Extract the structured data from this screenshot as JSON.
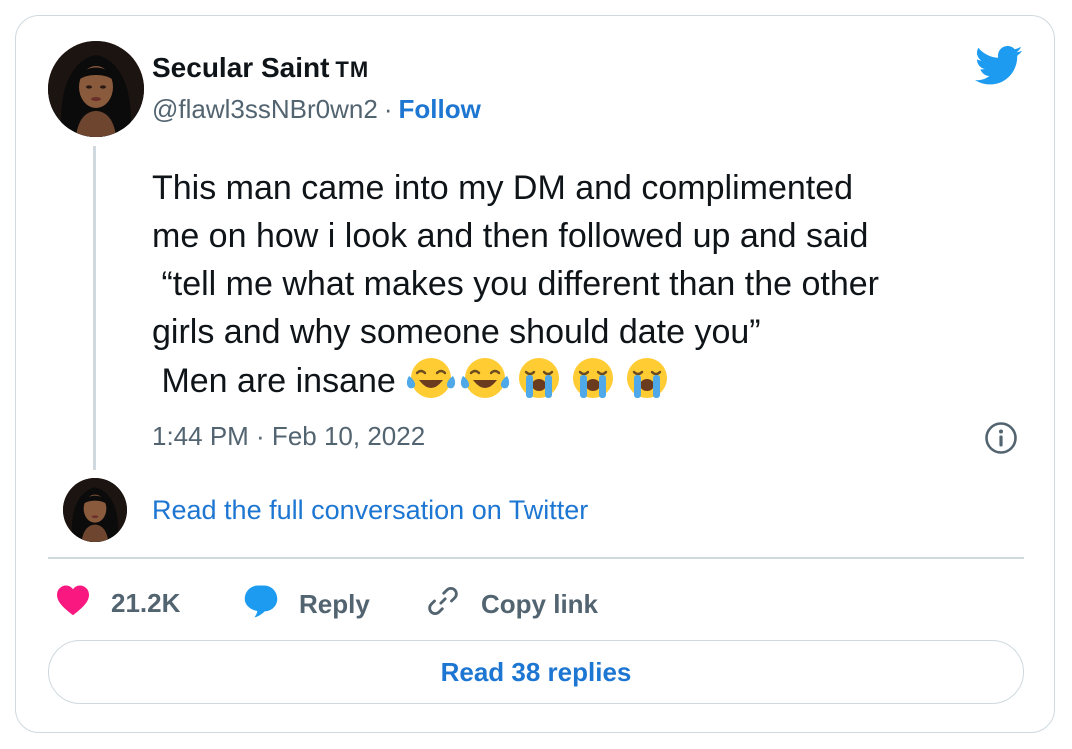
{
  "author": {
    "name": "Secular Saint",
    "name_suffix": "TM",
    "handle": "@flawl3ssNBr0wn2",
    "separator": "·",
    "follow_label": "Follow"
  },
  "tweet": {
    "lines": [
      "This man came into my DM and complimented",
      "me on how i look and then followed up and said",
      " “tell me what makes you different than the other",
      "girls and why someone should date you”",
      " Men are insane"
    ],
    "emojis": [
      "face-with-tears-of-joy",
      "face-with-tears-of-joy",
      "loudly-crying-face",
      "loudly-crying-face",
      "loudly-crying-face"
    ],
    "timestamp": "1:44 PM · Feb 10, 2022"
  },
  "conversation_link": "Read the full conversation on Twitter",
  "actions": {
    "likes_count": "21.2K",
    "reply_label": "Reply",
    "copy_link_label": "Copy link"
  },
  "read_replies_label": "Read 38 replies",
  "colors": {
    "link": "#1d76d2",
    "heart": "#f91880",
    "reply_bubble": "#1d9bf0",
    "twitter_blue": "#1d9bf0",
    "muted": "#536471",
    "border": "#cfd9de"
  }
}
